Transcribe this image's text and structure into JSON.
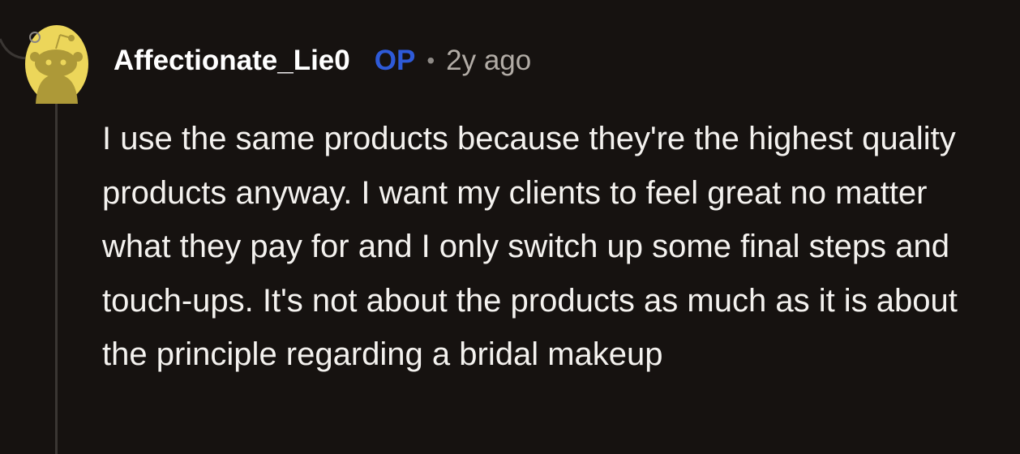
{
  "comment": {
    "author": "Affectionate_Lie0",
    "op_label": "OP",
    "separator": "•",
    "age": "2y ago",
    "body": "I use the same products because they're the highest quality products anyway. I want my clients to feel great no matter what they pay for and I only switch up some final steps and touch-ups. It's not about the products as much as it is about the principle regarding a bridal makeup"
  },
  "avatar": {
    "icon": "reddit-snoo-avatar-icon",
    "background_color": "#ecd65a",
    "figure_color": "#ad9938"
  },
  "colors": {
    "page_background": "#161210",
    "username": "#ffffff",
    "op_badge": "#2e5ad8",
    "meta_text": "#b2aca6",
    "body_text": "#f4f2ef",
    "thread_line": "#3a3633"
  }
}
